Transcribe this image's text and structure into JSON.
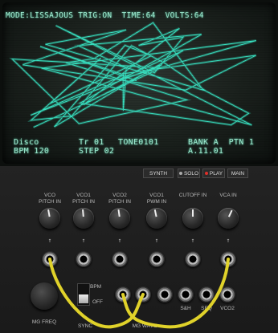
{
  "screen": {
    "mode_line": "MODE:LISSAJOUS TRIG:ON  TIME:64  VOLTS:64",
    "song": "Disco",
    "bpm": "BPM 120",
    "track": "Tr 01",
    "step": "STEP 02",
    "tone": "TONE0101",
    "bank": "BANK A  PTN 1",
    "position": "A.11.01",
    "trace_color": "#38e0c0"
  },
  "buttons": {
    "synth": "SYNTH",
    "solo": "SOLO",
    "play": "PLAY",
    "main": "MAIN",
    "play_color": "#e0302a"
  },
  "inputs": [
    {
      "line1": "VCO",
      "line2": "PITCH IN"
    },
    {
      "line1": "VCO1",
      "line2": "PITCH IN"
    },
    {
      "line1": "VCO2",
      "line2": "PITCH IN"
    },
    {
      "line1": "VCO1",
      "line2": "PWM IN"
    },
    {
      "line1": "",
      "line2": "CUTOFF IN"
    },
    {
      "line1": "",
      "line2": "VCA IN"
    }
  ],
  "bottom": {
    "mg_freq": "MG FREQ",
    "bpm_label": "BPM",
    "off_label": "OFF",
    "sync_label": "SYNC",
    "mg_wave_label": "MG WAVE",
    "seq_label": "SEQ",
    "vco2_label": "VCO2",
    "ssh_label": "S&H",
    "cable_color": "#e0d22a"
  }
}
